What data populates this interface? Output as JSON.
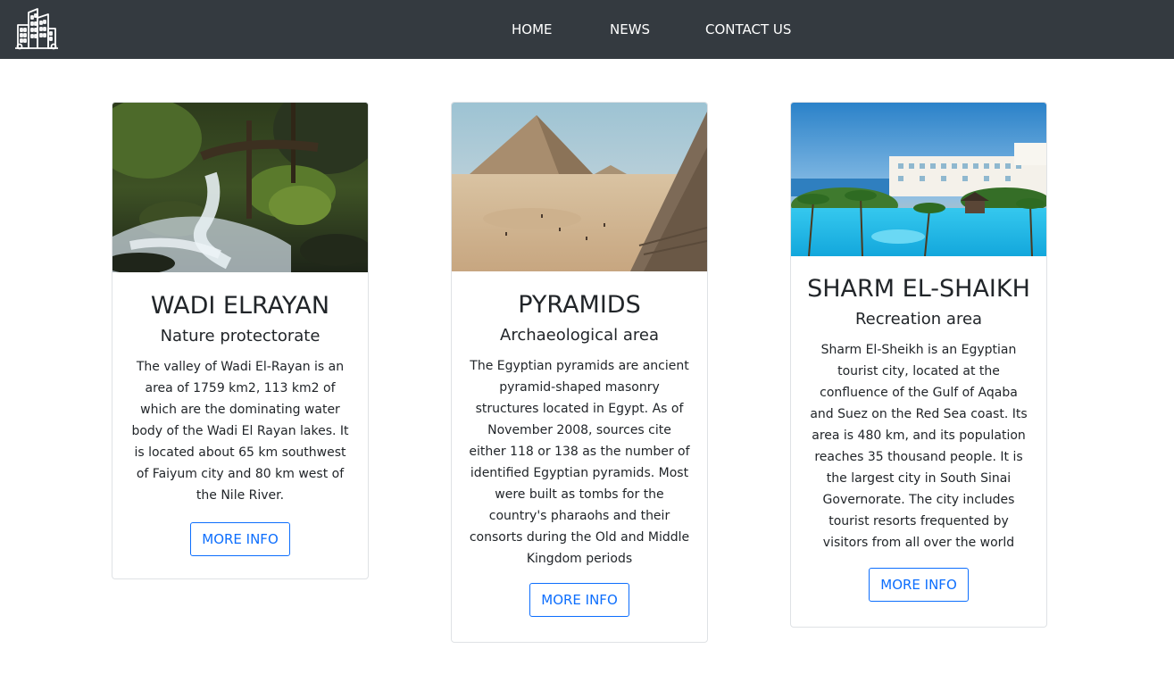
{
  "navbar": {
    "logo_icon": "city-buildings-icon",
    "links": [
      {
        "label": "HOME"
      },
      {
        "label": "NEWS"
      },
      {
        "label": "CONTACT US"
      }
    ]
  },
  "cards": [
    {
      "image_subject": "forest waterfall",
      "title": "WADI ELRAYAN",
      "subtitle": "Nature protectorate",
      "text": "The valley of Wadi El-Rayan is an area of 1759 km2, 113 km2 of which are the dominating water body of the Wadi El Rayan lakes. It is located about 65 km southwest of Faiyum city and 80 km west of the Nile River.",
      "button_label": "MORE INFO"
    },
    {
      "image_subject": "Giza pyramid in desert",
      "title": "PYRAMIDS",
      "subtitle": "Archaeological area",
      "text": "The Egyptian pyramids are ancient pyramid-shaped masonry structures located in Egypt. As of November 2008, sources cite either 118 or 138 as the number of identified Egyptian pyramids. Most were built as tombs for the country's pharaohs and their consorts during the Old and Middle Kingdom periods",
      "button_label": "MORE INFO"
    },
    {
      "image_subject": "resort with pool and sea",
      "title": "SHARM EL-SHAIKH",
      "subtitle": "Recreation area",
      "text": "Sharm El-Sheikh is an Egyptian tourist city, located at the confluence of the Gulf of Aqaba and Suez on the Red Sea coast. Its area is 480 km, and its population reaches 35 thousand people. It is the largest city in South Sinai Governorate. The city includes tourist resorts frequented by visitors from all over the world",
      "button_label": "MORE INFO"
    }
  ],
  "colors": {
    "navbar_bg": "#343a40",
    "button_blue": "#0d6efd"
  }
}
